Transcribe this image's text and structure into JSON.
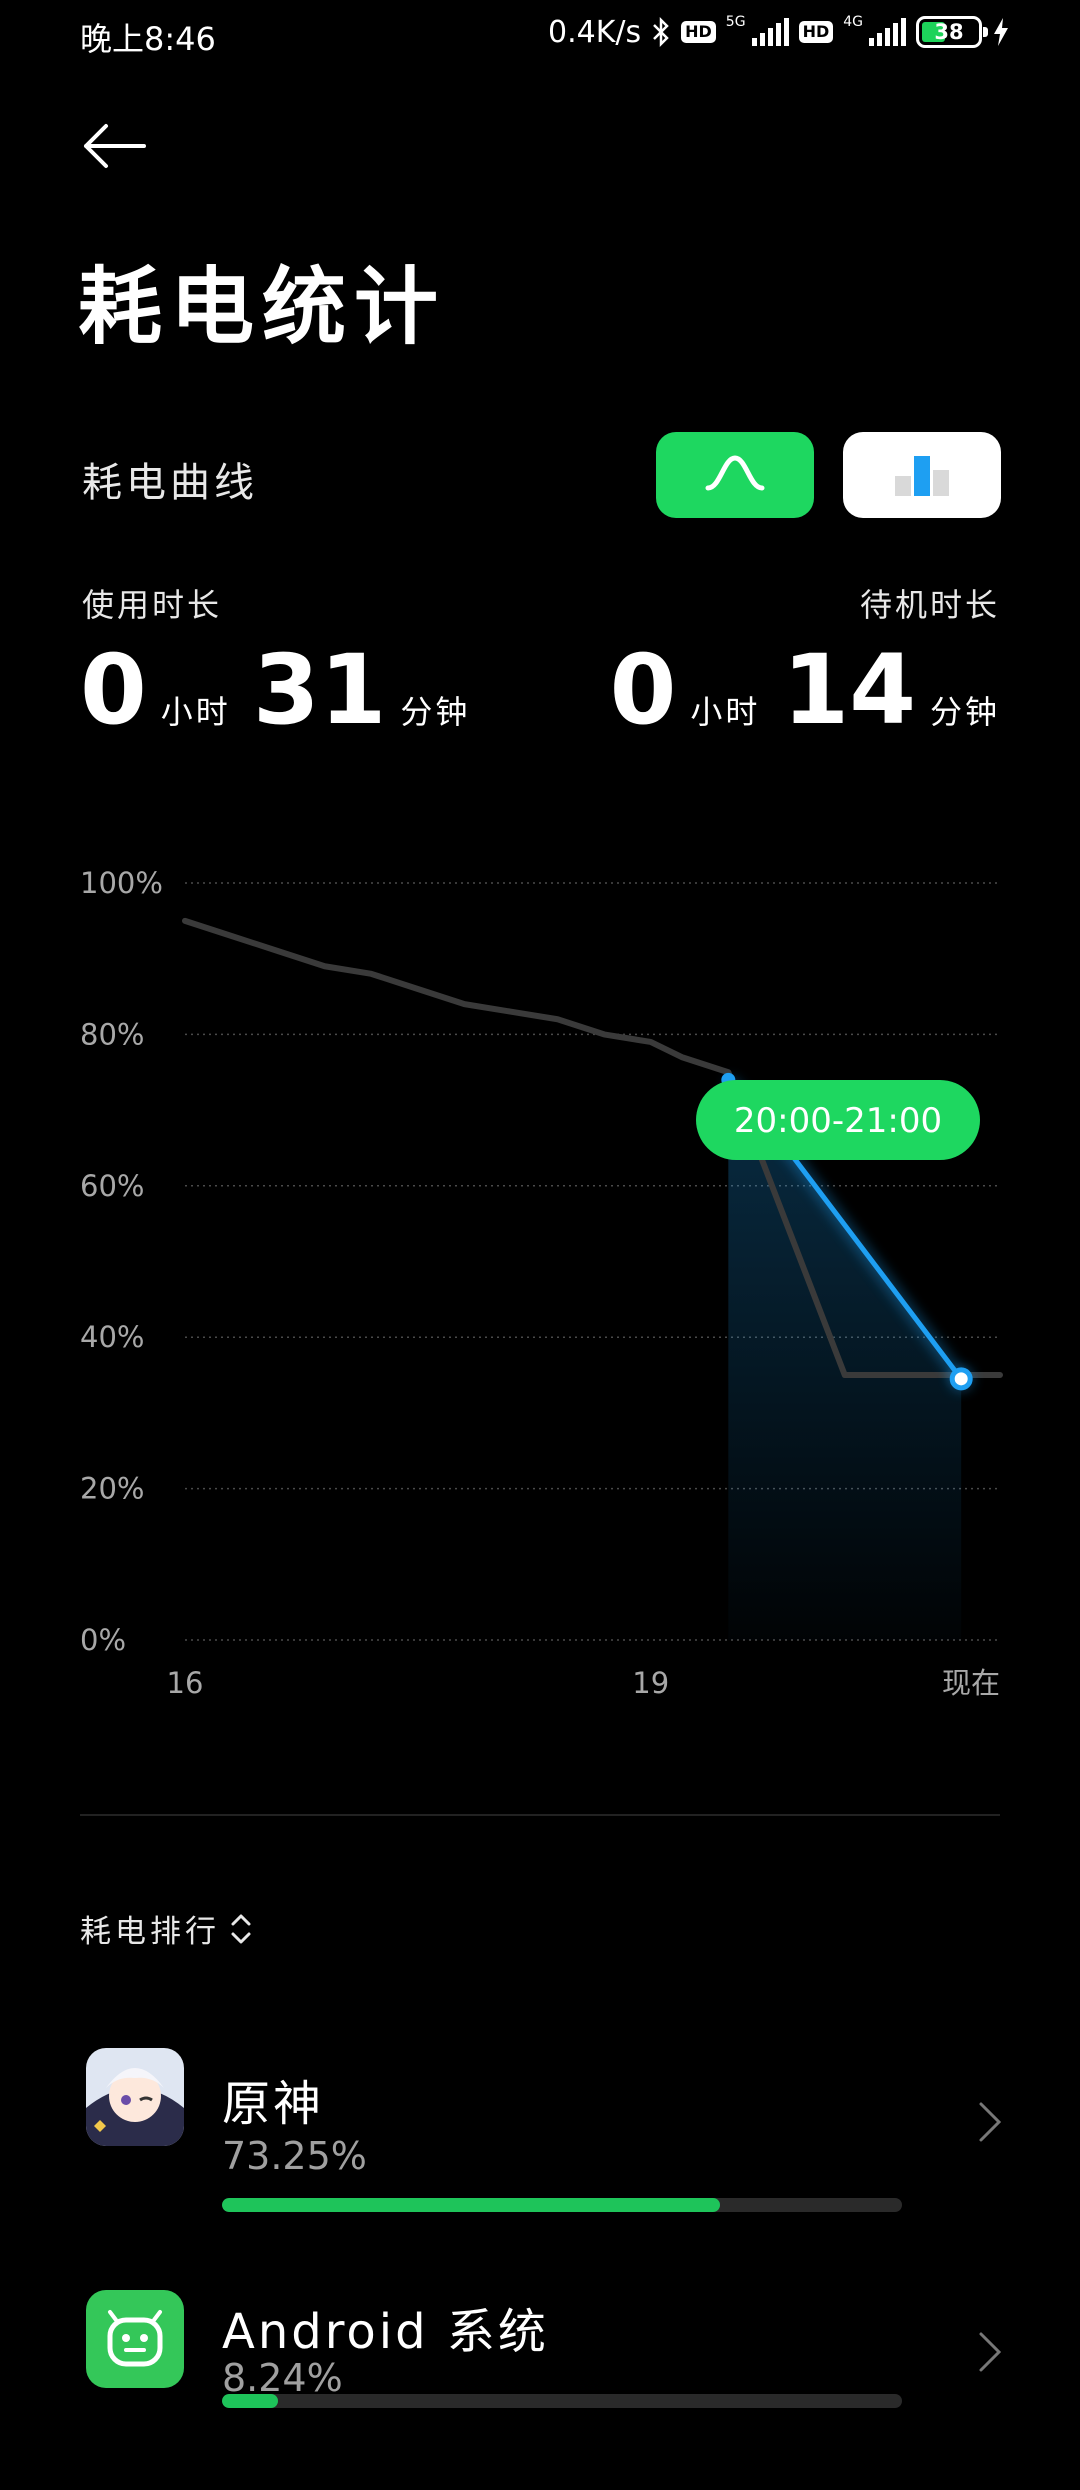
{
  "status_bar": {
    "time": "晚上8:46",
    "speed": "0.4K/s",
    "hd1": "HD",
    "net1": "5G",
    "hd2": "HD",
    "net2": "4G",
    "battery": "38"
  },
  "header": {
    "title": "耗电统计"
  },
  "curve_section": {
    "label": "耗电曲线",
    "toggle_curve_icon": "curve-icon",
    "toggle_bar_icon": "bar-chart-icon",
    "active_toggle": "curve"
  },
  "stats": {
    "usage_label": "使用时长",
    "usage_hours": "0",
    "usage_minutes": "31",
    "standby_label": "待机时长",
    "standby_hours": "0",
    "standby_minutes": "14",
    "hours_unit": "小时",
    "minutes_unit": "分钟"
  },
  "chart_data": {
    "type": "line",
    "y_ticks": [
      "100%",
      "80%",
      "60%",
      "40%",
      "20%",
      "0%"
    ],
    "ylim": [
      0,
      100
    ],
    "x_ticks": [
      {
        "label": "16",
        "hour": 16
      },
      {
        "label": "19",
        "hour": 19
      },
      {
        "label": "现在",
        "hour": 21
      }
    ],
    "xlim": [
      16,
      21.25
    ],
    "series": [
      {
        "color": "#3a3a3a",
        "points": [
          [
            16,
            95
          ],
          [
            16.3,
            93
          ],
          [
            16.6,
            91
          ],
          [
            16.9,
            89
          ],
          [
            17.2,
            88
          ],
          [
            17.5,
            86
          ],
          [
            17.8,
            84
          ],
          [
            18.1,
            83
          ],
          [
            18.4,
            82
          ],
          [
            18.7,
            80
          ],
          [
            19.0,
            79
          ],
          [
            19.2,
            77
          ],
          [
            19.5,
            75
          ],
          [
            20.25,
            35
          ],
          [
            21.25,
            35
          ]
        ]
      },
      {
        "color": "#1e9ff2",
        "points": [
          [
            19.5,
            74
          ],
          [
            19.8,
            67
          ],
          [
            21.0,
            34.5
          ]
        ]
      }
    ],
    "highlight": {
      "label": "20:00-21:00",
      "from": 19.5,
      "to": 21.0,
      "end_value": 34.5
    },
    "grid": true
  },
  "ranking": {
    "title": "耗电排行",
    "apps": [
      {
        "name": "原神",
        "percent": "73.25%",
        "value": 0.7325
      },
      {
        "name": "Android 系统",
        "percent": "8.24%",
        "value": 0.0824
      }
    ]
  },
  "colors": {
    "accent_green": "#1ed760",
    "accent_blue": "#1e9ff2",
    "background": "#000000"
  }
}
